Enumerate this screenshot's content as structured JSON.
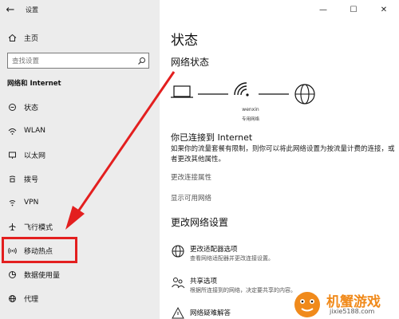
{
  "window": {
    "title": "设置",
    "back_glyph": "←",
    "controls": [
      "—",
      "☐",
      "✕"
    ]
  },
  "sidebar": {
    "home": {
      "icon": "home-icon",
      "label": "主页"
    },
    "search_placeholder": "查找设置",
    "group_title": "网络和 Internet",
    "items": [
      {
        "icon": "status-icon",
        "label": "状态"
      },
      {
        "icon": "wifi-icon",
        "label": "WLAN"
      },
      {
        "icon": "ethernet-icon",
        "label": "以太网"
      },
      {
        "icon": "dialup-icon",
        "label": "拨号"
      },
      {
        "icon": "vpn-icon",
        "label": "VPN"
      },
      {
        "icon": "airplane-icon",
        "label": "飞行模式"
      },
      {
        "icon": "hotspot-icon",
        "label": "移动热点"
      },
      {
        "icon": "data-usage-icon",
        "label": "数据使用量"
      },
      {
        "icon": "globe-icon",
        "label": "代理"
      }
    ]
  },
  "main": {
    "title": "状态",
    "network_status_heading": "网络状态",
    "network_name": "wenxin",
    "network_type": "专用网络",
    "connected_title": "你已连接到 Internet",
    "connected_desc": "如果你的流量套餐有限制，则你可以将此网络设置为按流量计费的连接，或者更改其他属性。",
    "link_properties": "更改连接属性",
    "link_available": "显示可用网络",
    "change_heading": "更改网络设置",
    "options": [
      {
        "icon": "adapter-icon",
        "title": "更改适配器选项",
        "desc": "查看网络适配器并更改连接设置。"
      },
      {
        "icon": "sharing-icon",
        "title": "共享选项",
        "desc": "根据所连接到的网络，决定要共享的内容。"
      },
      {
        "icon": "troubleshoot-icon",
        "title": "网络疑难解答",
        "desc": ""
      }
    ]
  },
  "watermark": {
    "name": "机蟹游戏",
    "url": "jixie5188.com"
  },
  "colors": {
    "sidebar_bg": "#ececec",
    "highlight": "#e31f1f",
    "watermark": "#f08a1b"
  }
}
